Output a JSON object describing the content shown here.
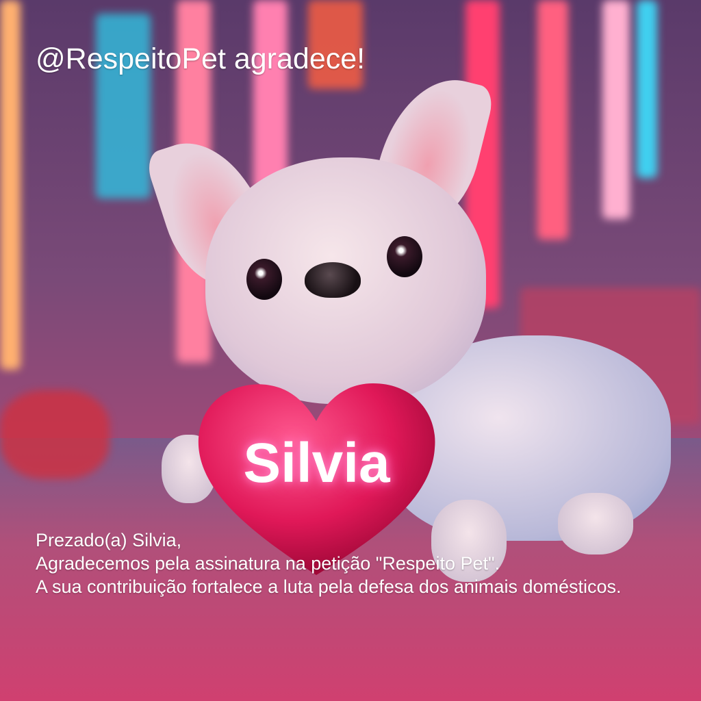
{
  "header": {
    "title": "@RespeitoPet agradece!"
  },
  "heart": {
    "name": "Silvia"
  },
  "message": {
    "greeting": "Prezado(a) Silvia,",
    "line1": "Agradecemos pela assinatura na petição \"Respeito Pet\".",
    "line2": "A sua contribuição fortalece a luta pela defesa dos animais domésticos."
  },
  "colors": {
    "heart": "#e0205a",
    "text": "#ffffff"
  }
}
